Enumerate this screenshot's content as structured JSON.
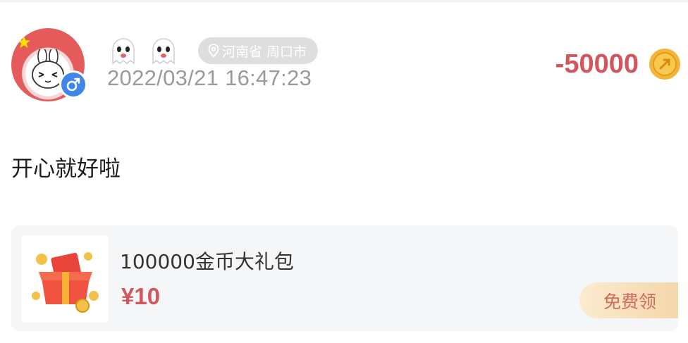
{
  "post": {
    "user": {
      "avatar_icon": "rabbit-avatar",
      "gender_icon": "male-icon",
      "gender_color": "#3f86e8",
      "badges": [
        "ghost-icon",
        "ghost-icon"
      ]
    },
    "location": "河南省 周口市",
    "location_icon": "map-pin-icon",
    "timestamp": "2022/03/21 16:47:23",
    "amount": "-50000",
    "amount_color": "#d3555e",
    "coin_icon": "gold-coin-icon",
    "content": "开心就好啦"
  },
  "product": {
    "thumb_icon": "gift-box-icon",
    "title": "100000金币大礼包",
    "price": "¥10",
    "button_label": "免费领"
  }
}
